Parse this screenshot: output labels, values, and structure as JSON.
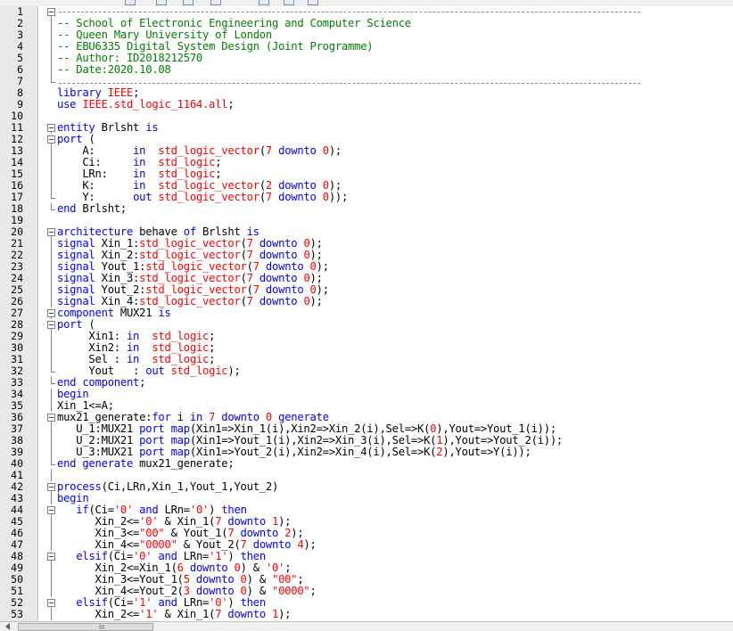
{
  "colors": {
    "background": "#ffffff",
    "gutter": "#e8e8e8",
    "kw": "#0000ff",
    "type": "#ff0000",
    "str": "#ff0000",
    "cm": "#008000",
    "id": "#000000"
  },
  "scrollbar": {
    "grip": "III"
  },
  "lines": [
    {
      "n": "1",
      "fold": "box",
      "dash": 95,
      "t": []
    },
    {
      "n": "2",
      "vline": true,
      "t": [
        [
          "cm",
          "-- School of Electronic Engineering and Computer Science"
        ]
      ]
    },
    {
      "n": "3",
      "vline": true,
      "t": [
        [
          "cm",
          "-- Queen Mary University of London"
        ]
      ]
    },
    {
      "n": "4",
      "vline": true,
      "t": [
        [
          "cm",
          "-- EBU6335 Digital System Design (Joint Programme)"
        ]
      ]
    },
    {
      "n": "5",
      "vline": true,
      "t": [
        [
          "cm",
          "-- Author: ID2018212570"
        ]
      ]
    },
    {
      "n": "6",
      "vline": true,
      "t": [
        [
          "cm",
          "-- Date:2020.10.08"
        ]
      ]
    },
    {
      "n": "7",
      "fold": "end",
      "dash": 95,
      "t": []
    },
    {
      "n": "8",
      "t": [
        [
          "kw",
          "library "
        ],
        [
          "type",
          "IEEE"
        ],
        [
          "id",
          ";"
        ]
      ]
    },
    {
      "n": "9",
      "t": [
        [
          "kw",
          "use "
        ],
        [
          "type",
          "IEEE.std_logic_1164.all"
        ],
        [
          "id",
          ";"
        ]
      ]
    },
    {
      "n": "10",
      "t": []
    },
    {
      "n": "11",
      "fold": "box",
      "t": [
        [
          "kw",
          "entity "
        ],
        [
          "id",
          "Brlsht "
        ],
        [
          "kw",
          "is"
        ]
      ]
    },
    {
      "n": "12",
      "fold": "box",
      "t": [
        [
          "kw",
          "port "
        ],
        [
          "id",
          "("
        ]
      ]
    },
    {
      "n": "13",
      "vline": true,
      "t": [
        [
          "id",
          "    A:      "
        ],
        [
          "kw",
          "in  "
        ],
        [
          "type",
          "std_logic_vector"
        ],
        [
          "id",
          "("
        ],
        [
          "str",
          "7"
        ],
        [
          "kw",
          " downto "
        ],
        [
          "str",
          "0"
        ],
        [
          "id",
          ");"
        ]
      ]
    },
    {
      "n": "14",
      "vline": true,
      "t": [
        [
          "id",
          "    Ci:     "
        ],
        [
          "kw",
          "in  "
        ],
        [
          "type",
          "std_logic"
        ],
        [
          "id",
          ";"
        ]
      ]
    },
    {
      "n": "15",
      "vline": true,
      "t": [
        [
          "id",
          "    LRn:    "
        ],
        [
          "kw",
          "in  "
        ],
        [
          "type",
          "std_logic"
        ],
        [
          "id",
          ";"
        ]
      ]
    },
    {
      "n": "16",
      "vline": true,
      "t": [
        [
          "id",
          "    K:      "
        ],
        [
          "kw",
          "in  "
        ],
        [
          "type",
          "std_logic_vector"
        ],
        [
          "id",
          "("
        ],
        [
          "str",
          "2"
        ],
        [
          "kw",
          " downto "
        ],
        [
          "str",
          "0"
        ],
        [
          "id",
          ");"
        ]
      ]
    },
    {
      "n": "17",
      "fold": "end",
      "t": [
        [
          "id",
          "    Y:      "
        ],
        [
          "kw",
          "out "
        ],
        [
          "type",
          "std_logic_vector"
        ],
        [
          "id",
          "("
        ],
        [
          "str",
          "7"
        ],
        [
          "kw",
          " downto "
        ],
        [
          "str",
          "0"
        ],
        [
          "id",
          "));"
        ]
      ]
    },
    {
      "n": "18",
      "fold": "end",
      "t": [
        [
          "kw",
          "end "
        ],
        [
          "id",
          "Brlsht;"
        ]
      ]
    },
    {
      "n": "19",
      "t": []
    },
    {
      "n": "20",
      "fold": "box",
      "t": [
        [
          "kw",
          "architecture "
        ],
        [
          "id",
          "behave "
        ],
        [
          "kw",
          "of "
        ],
        [
          "id",
          "Brlsht "
        ],
        [
          "kw",
          "is"
        ]
      ]
    },
    {
      "n": "21",
      "vline": true,
      "t": [
        [
          "kw",
          "signal "
        ],
        [
          "id",
          "Xin_1:"
        ],
        [
          "type",
          "std_logic_vector"
        ],
        [
          "id",
          "("
        ],
        [
          "str",
          "7"
        ],
        [
          "kw",
          " downto "
        ],
        [
          "str",
          "0"
        ],
        [
          "id",
          ");"
        ]
      ]
    },
    {
      "n": "22",
      "vline": true,
      "t": [
        [
          "kw",
          "signal "
        ],
        [
          "id",
          "Xin_2:"
        ],
        [
          "type",
          "std_logic_vector"
        ],
        [
          "id",
          "("
        ],
        [
          "str",
          "7"
        ],
        [
          "kw",
          " downto "
        ],
        [
          "str",
          "0"
        ],
        [
          "id",
          ");"
        ]
      ]
    },
    {
      "n": "23",
      "vline": true,
      "t": [
        [
          "kw",
          "signal "
        ],
        [
          "id",
          "Yout_1:"
        ],
        [
          "type",
          "std_logic_vector"
        ],
        [
          "id",
          "("
        ],
        [
          "str",
          "7"
        ],
        [
          "kw",
          " downto "
        ],
        [
          "str",
          "0"
        ],
        [
          "id",
          ");"
        ]
      ]
    },
    {
      "n": "24",
      "vline": true,
      "t": [
        [
          "kw",
          "signal "
        ],
        [
          "id",
          "Xin_3:"
        ],
        [
          "type",
          "std_logic_vector"
        ],
        [
          "id",
          "("
        ],
        [
          "str",
          "7"
        ],
        [
          "kw",
          " downto "
        ],
        [
          "str",
          "0"
        ],
        [
          "id",
          ");"
        ]
      ]
    },
    {
      "n": "25",
      "vline": true,
      "t": [
        [
          "kw",
          "signal "
        ],
        [
          "id",
          "Yout_2:"
        ],
        [
          "type",
          "std_logic_vector"
        ],
        [
          "id",
          "("
        ],
        [
          "str",
          "7"
        ],
        [
          "kw",
          " downto "
        ],
        [
          "str",
          "0"
        ],
        [
          "id",
          ");"
        ]
      ]
    },
    {
      "n": "26",
      "vline": true,
      "t": [
        [
          "kw",
          "signal "
        ],
        [
          "id",
          "Xin_4:"
        ],
        [
          "type",
          "std_logic_vector"
        ],
        [
          "id",
          "("
        ],
        [
          "str",
          "7"
        ],
        [
          "kw",
          " downto "
        ],
        [
          "str",
          "0"
        ],
        [
          "id",
          ");"
        ]
      ]
    },
    {
      "n": "27",
      "fold": "box",
      "t": [
        [
          "kw",
          "component "
        ],
        [
          "id",
          "MUX21 "
        ],
        [
          "kw",
          "is"
        ]
      ]
    },
    {
      "n": "28",
      "fold": "box",
      "t": [
        [
          "kw",
          "port "
        ],
        [
          "id",
          "("
        ]
      ]
    },
    {
      "n": "29",
      "vline": true,
      "t": [
        [
          "id",
          "     Xin1: "
        ],
        [
          "kw",
          "in  "
        ],
        [
          "type",
          "std_logic"
        ],
        [
          "id",
          ";"
        ]
      ]
    },
    {
      "n": "30",
      "vline": true,
      "t": [
        [
          "id",
          "     Xin2: "
        ],
        [
          "kw",
          "in  "
        ],
        [
          "type",
          "std_logic"
        ],
        [
          "id",
          ";"
        ]
      ]
    },
    {
      "n": "31",
      "vline": true,
      "t": [
        [
          "id",
          "     Sel : "
        ],
        [
          "kw",
          "in  "
        ],
        [
          "type",
          "std_logic"
        ],
        [
          "id",
          ";"
        ]
      ]
    },
    {
      "n": "32",
      "fold": "end",
      "t": [
        [
          "id",
          "     Yout   : "
        ],
        [
          "kw",
          "out "
        ],
        [
          "type",
          "std_logic"
        ],
        [
          "id",
          ");"
        ]
      ]
    },
    {
      "n": "33",
      "fold": "end",
      "t": [
        [
          "kw",
          "end component"
        ],
        [
          "id",
          ";"
        ]
      ]
    },
    {
      "n": "34",
      "vline": true,
      "t": [
        [
          "kw",
          "begin"
        ]
      ]
    },
    {
      "n": "35",
      "vline": true,
      "t": [
        [
          "id",
          "Xin_1<=A;"
        ]
      ]
    },
    {
      "n": "36",
      "fold": "box",
      "t": [
        [
          "id",
          "mux21_generate:"
        ],
        [
          "kw",
          "for "
        ],
        [
          "id",
          "i "
        ],
        [
          "kw",
          "in "
        ],
        [
          "str",
          "7"
        ],
        [
          "kw",
          " downto "
        ],
        [
          "str",
          "0"
        ],
        [
          "kw",
          " generate"
        ]
      ]
    },
    {
      "n": "37",
      "vline": true,
      "t": [
        [
          "id",
          "   U_1:MUX21 "
        ],
        [
          "kw",
          "port map"
        ],
        [
          "id",
          "(Xin1=>Xin_1(i),Xin2=>Xin_2(i),Sel=>K("
        ],
        [
          "str",
          "0"
        ],
        [
          "id",
          "),Yout=>Yout_1(i));"
        ]
      ]
    },
    {
      "n": "38",
      "vline": true,
      "t": [
        [
          "id",
          "   U_2:MUX21 "
        ],
        [
          "kw",
          "port map"
        ],
        [
          "id",
          "(Xin1=>Yout_1(i),Xin2=>Xin_3(i),Sel=>K("
        ],
        [
          "str",
          "1"
        ],
        [
          "id",
          "),Yout=>Yout_2(i));"
        ]
      ]
    },
    {
      "n": "39",
      "vline": true,
      "t": [
        [
          "id",
          "   U_3:MUX21 "
        ],
        [
          "kw",
          "port map"
        ],
        [
          "id",
          "(Xin1=>Yout_2(i),Xin2=>Xin_4(i),Sel=>K("
        ],
        [
          "str",
          "2"
        ],
        [
          "id",
          "),Yout=>Y(i));"
        ]
      ]
    },
    {
      "n": "40",
      "fold": "end",
      "t": [
        [
          "kw",
          "end generate "
        ],
        [
          "id",
          "mux21_generate;"
        ]
      ]
    },
    {
      "n": "41",
      "vline": true,
      "t": []
    },
    {
      "n": "42",
      "fold": "box",
      "t": [
        [
          "kw",
          "process"
        ],
        [
          "id",
          "(Ci,LRn,Xin_1,Yout_1,Yout_2)"
        ]
      ]
    },
    {
      "n": "43",
      "vline": true,
      "t": [
        [
          "kw",
          "begin"
        ]
      ]
    },
    {
      "n": "44",
      "fold": "box",
      "t": [
        [
          "id",
          "   "
        ],
        [
          "kw",
          "if"
        ],
        [
          "id",
          "(Ci="
        ],
        [
          "str",
          "'0'"
        ],
        [
          "kw",
          " and "
        ],
        [
          "id",
          "LRn="
        ],
        [
          "str",
          "'0'"
        ],
        [
          "id",
          ") "
        ],
        [
          "kw",
          "then"
        ]
      ]
    },
    {
      "n": "45",
      "vline": true,
      "t": [
        [
          "id",
          "      Xin_2<="
        ],
        [
          "str",
          "'0'"
        ],
        [
          "id",
          " & Xin_1("
        ],
        [
          "str",
          "7"
        ],
        [
          "kw",
          " downto "
        ],
        [
          "str",
          "1"
        ],
        [
          "id",
          ");"
        ]
      ]
    },
    {
      "n": "46",
      "vline": true,
      "t": [
        [
          "id",
          "      Xin_3<="
        ],
        [
          "str",
          "\"00\""
        ],
        [
          "id",
          " & Yout_1("
        ],
        [
          "str",
          "7"
        ],
        [
          "kw",
          " downto "
        ],
        [
          "str",
          "2"
        ],
        [
          "id",
          ");"
        ]
      ]
    },
    {
      "n": "47",
      "vline": true,
      "t": [
        [
          "id",
          "      Xin_4<="
        ],
        [
          "str",
          "\"0000\""
        ],
        [
          "id",
          " & Yout_2("
        ],
        [
          "str",
          "7"
        ],
        [
          "kw",
          " downto "
        ],
        [
          "str",
          "4"
        ],
        [
          "id",
          ");"
        ]
      ]
    },
    {
      "n": "48",
      "fold": "box",
      "t": [
        [
          "id",
          "   "
        ],
        [
          "kw",
          "elsif"
        ],
        [
          "id",
          "(Ci="
        ],
        [
          "str",
          "'0'"
        ],
        [
          "kw",
          " and "
        ],
        [
          "id",
          "LRn="
        ],
        [
          "str",
          "'1'"
        ],
        [
          "id",
          ") "
        ],
        [
          "kw",
          "then"
        ]
      ]
    },
    {
      "n": "49",
      "vline": true,
      "t": [
        [
          "id",
          "      Xin_2<=Xin_1("
        ],
        [
          "str",
          "6"
        ],
        [
          "kw",
          " downto "
        ],
        [
          "str",
          "0"
        ],
        [
          "id",
          ") & "
        ],
        [
          "str",
          "'0'"
        ],
        [
          "id",
          ";"
        ]
      ]
    },
    {
      "n": "50",
      "vline": true,
      "t": [
        [
          "id",
          "      Xin_3<=Yout_1("
        ],
        [
          "str",
          "5"
        ],
        [
          "kw",
          " downto "
        ],
        [
          "str",
          "0"
        ],
        [
          "id",
          ") & "
        ],
        [
          "str",
          "\"00\""
        ],
        [
          "id",
          ";"
        ]
      ]
    },
    {
      "n": "51",
      "vline": true,
      "t": [
        [
          "id",
          "      Xin_4<=Yout_2("
        ],
        [
          "str",
          "3"
        ],
        [
          "kw",
          " downto "
        ],
        [
          "str",
          "0"
        ],
        [
          "id",
          ") & "
        ],
        [
          "str",
          "\"0000\""
        ],
        [
          "id",
          ";"
        ]
      ]
    },
    {
      "n": "52",
      "fold": "box",
      "t": [
        [
          "id",
          "   "
        ],
        [
          "kw",
          "elsif"
        ],
        [
          "id",
          "(Ci="
        ],
        [
          "str",
          "'1'"
        ],
        [
          "kw",
          " and "
        ],
        [
          "id",
          "LRn="
        ],
        [
          "str",
          "'0'"
        ],
        [
          "id",
          ") "
        ],
        [
          "kw",
          "then"
        ]
      ]
    },
    {
      "n": "53",
      "vline": true,
      "t": [
        [
          "id",
          "      Xin_2<="
        ],
        [
          "str",
          "'1'"
        ],
        [
          "id",
          " & Xin_1("
        ],
        [
          "str",
          "7"
        ],
        [
          "kw",
          " downto "
        ],
        [
          "str",
          "1"
        ],
        [
          "id",
          ");"
        ]
      ]
    }
  ]
}
